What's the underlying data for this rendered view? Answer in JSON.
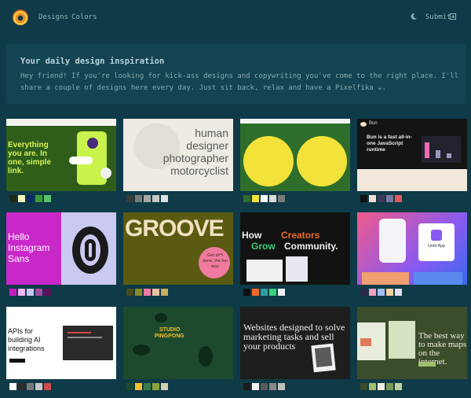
{
  "nav": {
    "designs_label": "Designs",
    "colors_label": "Colors",
    "submit_label": "Submit"
  },
  "hero": {
    "title": "Your daily design inspiration",
    "body": "Hey friend! If you're looking for kick-ass designs and copywriting you've come to the right place. I'll share a couple of designs here every day. Just sit back, relax and have a Pixelfika ☕."
  },
  "cards": [
    {
      "id": "c1",
      "texts": {
        "headline": "Everything you are. In one, simple link."
      },
      "swatches": [
        "#1f2a12",
        "#f2f5b5",
        "#0a2a6a",
        "#3a9b3a",
        "#57c06a"
      ]
    },
    {
      "id": "c2",
      "texts": {
        "l1": "human",
        "l2": "designer",
        "l3": "photographer",
        "l4": "motorcyclist"
      },
      "swatches": [
        "#3a3a3a",
        "#7a7a7a",
        "#a8a8a8",
        "#c8c8c8",
        "#e0e0e0"
      ]
    },
    {
      "id": "c3",
      "texts": {},
      "swatches": [
        "#2e6b2a",
        "#f3e23a",
        "#ffffff",
        "#dcdcdc",
        "#7a7a7a"
      ]
    },
    {
      "id": "c4",
      "texts": {
        "brand": "Bun",
        "headline": "Bun is a fast all-in-one JavaScript runtime"
      },
      "swatches": [
        "#111111",
        "#f3e0d5",
        "#3a3a5a",
        "#7a7aa0",
        "#e25a5a"
      ]
    },
    {
      "id": "c5",
      "texts": {
        "headline": "Hello Instagram Sans"
      },
      "swatches": [
        "#c020c0",
        "#f2b8f2",
        "#c7c7f0",
        "#a04aa0",
        "#5a105a"
      ]
    },
    {
      "id": "c6",
      "texts": {
        "headline": "GROOVE",
        "bubble": "Get sh*t done, the fun way"
      },
      "swatches": [
        "#4a4a1a",
        "#8a8a2a",
        "#f07aa0",
        "#e8c0a0",
        "#c8b060"
      ]
    },
    {
      "id": "c7",
      "texts": {
        "l1": "How",
        "l2": "Creators",
        "l3": "Grow",
        "l4": "Community."
      },
      "swatches": [
        "#111111",
        "#f06a2a",
        "#2aa0a0",
        "#3ad07a",
        "#f0f0f0"
      ]
    },
    {
      "id": "c8",
      "texts": {
        "app": "Until App"
      },
      "swatches": [
        "#2a2a4a",
        "#f0a0c0",
        "#a0c0f0",
        "#f0d0a0",
        "#e0e0f0"
      ]
    },
    {
      "id": "c9",
      "texts": {
        "headline": "APIs for building AI integrations"
      },
      "swatches": [
        "#ffffff",
        "#2a2a2a",
        "#7a7a7a",
        "#c8c8c8",
        "#d04a4a"
      ]
    },
    {
      "id": "c10",
      "texts": {
        "l1": "STUDIO",
        "l2": "PINGPONG"
      },
      "swatches": [
        "#1a4a2a",
        "#f3c030",
        "#3a7a4a",
        "#8aa03a",
        "#d0d0b0"
      ]
    },
    {
      "id": "c11",
      "texts": {
        "headline": "Websites designed to solve marketing tasks and sell your products"
      },
      "swatches": [
        "#1a1a1a",
        "#f0f0f0",
        "#5a5a5a",
        "#8a8a8a",
        "#c0c0c0"
      ]
    },
    {
      "id": "c12",
      "texts": {
        "headline": "The best way to make maps on the internet."
      },
      "swatches": [
        "#3a4a2a",
        "#a0c070",
        "#f0f0e0",
        "#7a9a5a",
        "#c0d0a0"
      ]
    }
  ]
}
